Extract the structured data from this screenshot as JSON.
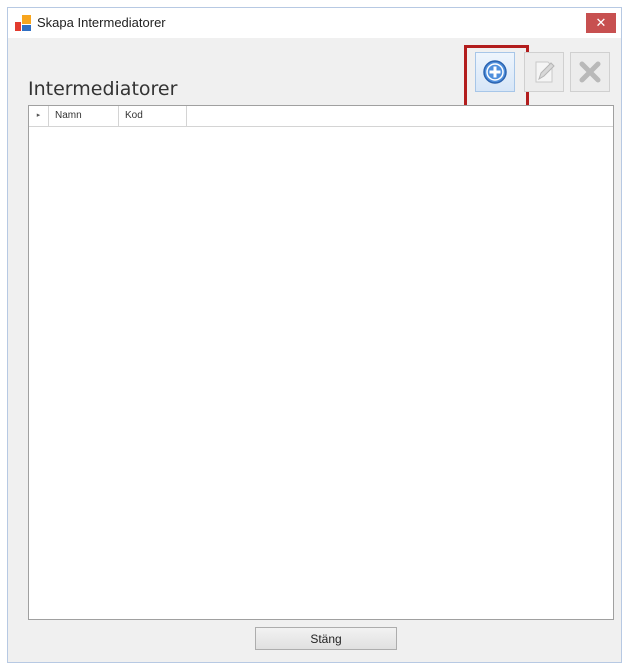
{
  "window": {
    "title": "Skapa Intermediatorer",
    "close_glyph": "✕"
  },
  "heading": "Intermediatorer",
  "toolbar": {
    "add": {
      "icon": "plus-circle-icon",
      "accent": "#3a7fd5"
    },
    "edit": {
      "icon": "pencil-icon"
    },
    "delete": {
      "icon": "x-icon"
    },
    "highlight_color": "#b21d1d"
  },
  "grid": {
    "row_indicator": "▸",
    "columns": [
      "Namn",
      "Kod"
    ],
    "rows": []
  },
  "footer": {
    "close_label": "Stäng"
  }
}
